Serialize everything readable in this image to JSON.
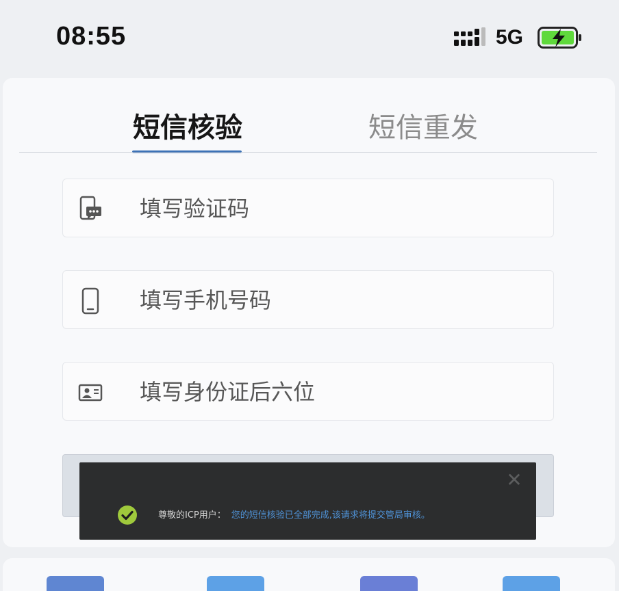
{
  "status_bar": {
    "time": "08:55",
    "network": "5G",
    "icons": [
      "signal-icon",
      "battery-charging-icon"
    ]
  },
  "tabs": [
    {
      "label": "短信核验",
      "active": true
    },
    {
      "label": "短信重发",
      "active": false
    }
  ],
  "form": {
    "code_placeholder": "填写验证码",
    "phone_placeholder": "填写手机号码",
    "id_placeholder": "填写身份证后六位"
  },
  "toast": {
    "prefix": "尊敬的ICP用户：",
    "message": "您的短信核验已全部完成,该请求将提交管局审核。",
    "close_symbol": "✕"
  },
  "colors": {
    "accent": "#3d72b6",
    "toast_bg": "#2c2d2e",
    "toast_message": "#4f93d8",
    "check": "#9fc93c",
    "battery": "#5fd93c",
    "bottom_buttons": [
      "#5f86d2",
      "#5da1e6",
      "#6a7fd6",
      "#5da1e6"
    ]
  }
}
